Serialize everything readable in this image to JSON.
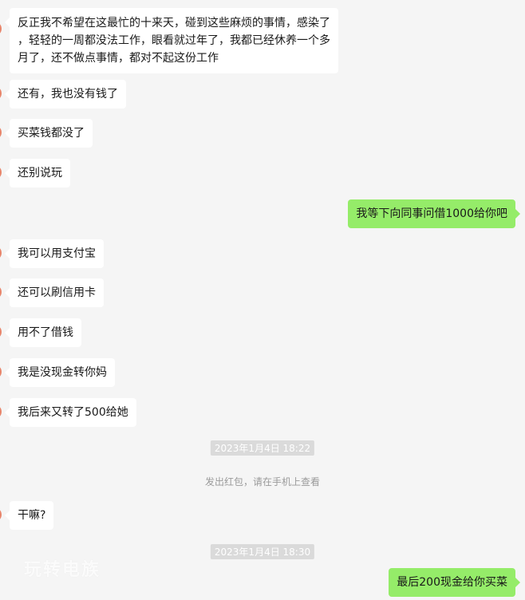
{
  "messages": [
    {
      "side": "in",
      "lines": [
        "反正我不希望在这最忙的十来天，碰到这些麻烦的事情，感染了",
        "，轻轻的一周都没法工作，眼看就过年了，我都已经休养一个多",
        "月了，还不做点事情，都对不起这份工作"
      ]
    },
    {
      "side": "in",
      "text": "还有，我也没有钱了"
    },
    {
      "side": "in",
      "text": "买菜钱都没了"
    },
    {
      "side": "in",
      "text": "还别说玩"
    },
    {
      "side": "out",
      "text": "我等下向同事问借1000给你吧"
    },
    {
      "side": "in",
      "text": "我可以用支付宝"
    },
    {
      "side": "in",
      "text": "还可以刷信用卡"
    },
    {
      "side": "in",
      "text": "用不了借钱"
    },
    {
      "side": "in",
      "text": "我是没现金转你妈"
    },
    {
      "side": "in",
      "text": "我后来又转了500给她"
    },
    {
      "side": "time",
      "text": "2023年1月4日 18:22"
    },
    {
      "side": "system",
      "text": "发出红包，请在手机上查看"
    },
    {
      "side": "in",
      "text": "干嘛?"
    },
    {
      "side": "time",
      "text": "2023年1月4日 18:30"
    },
    {
      "side": "out",
      "text": "最后200现金给你买菜"
    }
  ],
  "watermark": "玩转电族"
}
